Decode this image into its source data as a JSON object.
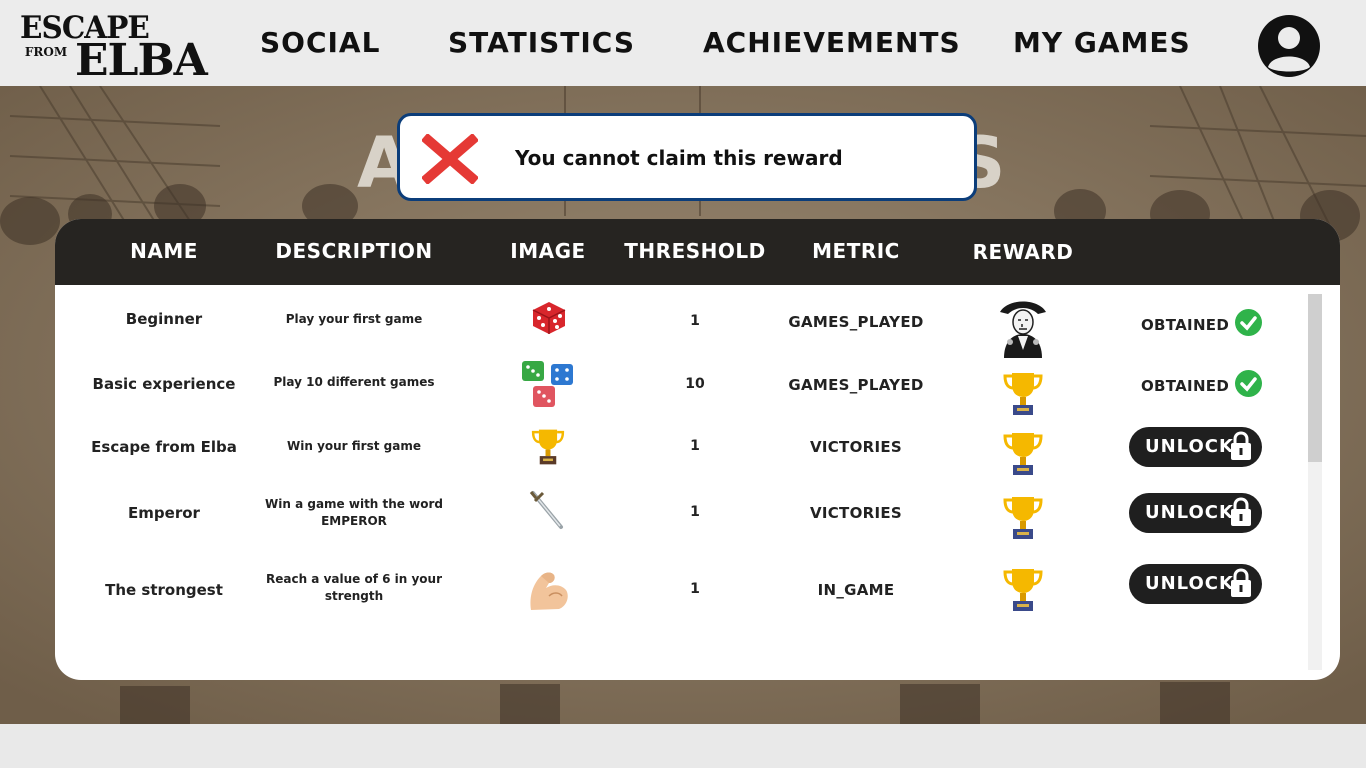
{
  "logo": {
    "line1": "ESCAPE",
    "line2": "FROM",
    "line3": "ELBA"
  },
  "nav": {
    "social": "SOCIAL",
    "statistics": "STATISTICS",
    "achievements": "ACHIEVEMENTS",
    "my_games": "MY GAMES"
  },
  "page_title": {
    "left": "A",
    "right": "S"
  },
  "toast": {
    "message": "You cannot claim this reward",
    "icon": "red-x-icon",
    "border_color": "#0b3d7a"
  },
  "table": {
    "headers": {
      "name": "NAME",
      "description": "DESCRIPTION",
      "image": "IMAGE",
      "threshold": "THRESHOLD",
      "metric": "METRIC",
      "reward": "REWARD"
    },
    "rows": [
      {
        "name": "Beginner",
        "description": "Play your first game",
        "image": "red-dice-icon",
        "threshold": "1",
        "metric": "GAMES_PLAYED",
        "reward": "napoleon-portrait-icon",
        "status": "OBTAINED"
      },
      {
        "name": "Basic experience",
        "description": "Play 10 different games",
        "image": "colored-dice-icon",
        "threshold": "10",
        "metric": "GAMES_PLAYED",
        "reward": "trophy-icon",
        "status": "OBTAINED"
      },
      {
        "name": "Escape from Elba",
        "description": "Win your first game",
        "image": "trophy-icon",
        "threshold": "1",
        "metric": "VICTORIES",
        "reward": "trophy-icon",
        "status": "UNLOCK"
      },
      {
        "name": "Emperor",
        "description": "Win a game with the word EMPEROR",
        "description_l1": "Win a game with the word",
        "description_l2": "EMPEROR",
        "image": "sword-icon",
        "threshold": "1",
        "metric": "VICTORIES",
        "reward": "trophy-icon",
        "status": "UNLOCK"
      },
      {
        "name": "The strongest",
        "description": "Reach a value of 6 in your strength",
        "description_l1": "Reach a value of 6 in your",
        "description_l2": "strength",
        "image": "flexed-bicep-icon",
        "threshold": "1",
        "metric": "IN_GAME",
        "reward": "trophy-icon",
        "status": "UNLOCK"
      }
    ]
  },
  "colors": {
    "header_bg": "#262421",
    "obtained_check": "#2fb34a",
    "unlock_bg": "#1f1f1f",
    "trophy": "#f5b800"
  }
}
